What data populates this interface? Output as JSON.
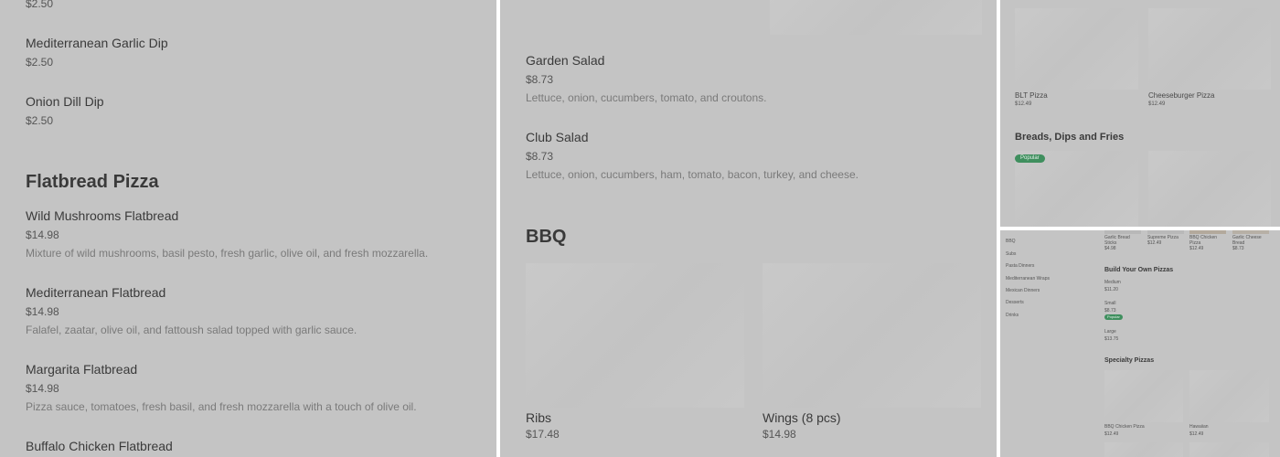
{
  "panel1": {
    "top_price": "$2.50",
    "dips": [
      {
        "name": "Mediterranean Garlic Dip",
        "price": "$2.50"
      },
      {
        "name": "Onion Dill Dip",
        "price": "$2.50"
      }
    ],
    "section_title": "Flatbread Pizza",
    "items": [
      {
        "name": "Wild Mushrooms Flatbread",
        "price": "$14.98",
        "desc": "Mixture of wild mushrooms, basil pesto, fresh garlic, olive oil, and fresh mozzarella."
      },
      {
        "name": "Mediterranean Flatbread",
        "price": "$14.98",
        "desc": "Falafel, zaatar, olive oil, and fattoush salad topped with garlic sauce."
      },
      {
        "name": "Margarita Flatbread",
        "price": "$14.98",
        "desc": "Pizza sauce, tomatoes, fresh basil, and fresh mozzarella with a touch of olive oil."
      }
    ],
    "last_item_name": "Buffalo Chicken Flatbread"
  },
  "panel2": {
    "salads": [
      {
        "name": "Garden Salad",
        "price": "$8.73",
        "desc": "Lettuce, onion, cucumbers, tomato, and croutons."
      },
      {
        "name": "Club Salad",
        "price": "$8.73",
        "desc": "Lettuce, onion, cucumbers, ham, tomato, bacon, turkey, and cheese."
      }
    ],
    "section_title": "BBQ",
    "bbq": [
      {
        "name": "Ribs",
        "price": "$17.48"
      },
      {
        "name": "Wings (8 pcs)",
        "price": "$14.98"
      }
    ]
  },
  "panel3": {
    "cards": [
      {
        "name": "BLT Pizza",
        "price": "$12.49"
      },
      {
        "name": "Cheeseburger Pizza",
        "price": "$12.49"
      }
    ],
    "section_title": "Breads, Dips and Fries",
    "badge": "Popular"
  },
  "panel4": {
    "sidebar": [
      "BBQ",
      "Subs",
      "Pasta Dinners",
      "Mediterranean Wraps",
      "Mexican Dinners",
      "Desserts",
      "Drinks"
    ],
    "top_cards": [
      {
        "name": "Garlic Bread Sticks",
        "price": "$4.98"
      },
      {
        "name": "Supreme Pizza",
        "price": "$12.49"
      },
      {
        "name": "BBQ Chicken Pizza",
        "price": "$12.49"
      },
      {
        "name": "Garlic Cheese Bread",
        "price": "$8.73"
      }
    ],
    "build_title": "Build Your Own Pizzas",
    "sizes": [
      {
        "name": "Medium",
        "price": "$11.20"
      },
      {
        "name": "Small",
        "price": "$8.73"
      },
      {
        "name": "Large",
        "price": "$13.75"
      }
    ],
    "badge": "Popular",
    "specialty_title": "Specialty Pizzas",
    "specialty_cards": [
      {
        "name": "BBQ Chicken Pizza",
        "price": "$12.49"
      },
      {
        "name": "Hawaiian",
        "price": "$12.49"
      }
    ]
  }
}
